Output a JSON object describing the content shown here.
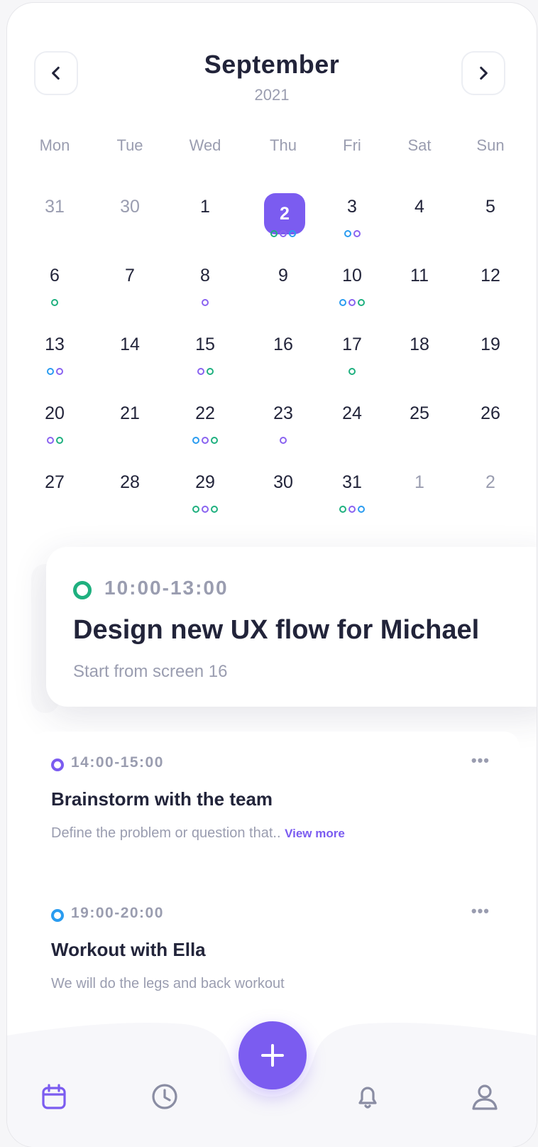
{
  "header": {
    "month": "September",
    "year": "2021",
    "prev_icon": "chevron-left-icon",
    "next_icon": "chevron-right-icon"
  },
  "calendar": {
    "weekdays": [
      "Mon",
      "Tue",
      "Wed",
      "Thu",
      "Fri",
      "Sat",
      "Sun"
    ],
    "colors": {
      "green": "#1fb07f",
      "purple": "#8a63f0",
      "blue": "#2a9cf0"
    },
    "selected_day": "2",
    "weeks": [
      [
        {
          "d": "31",
          "muted": true,
          "dots": []
        },
        {
          "d": "30",
          "muted": true,
          "dots": []
        },
        {
          "d": "1",
          "dots": []
        },
        {
          "d": "2",
          "selected": true,
          "dots": [
            "green",
            "purple",
            "blue"
          ]
        },
        {
          "d": "3",
          "dots": [
            "blue",
            "purple"
          ]
        },
        {
          "d": "4",
          "dots": []
        },
        {
          "d": "5",
          "dots": []
        }
      ],
      [
        {
          "d": "6",
          "dots": [
            "green"
          ]
        },
        {
          "d": "7",
          "dots": []
        },
        {
          "d": "8",
          "dots": [
            "purple"
          ]
        },
        {
          "d": "9",
          "dots": []
        },
        {
          "d": "10",
          "dots": [
            "blue",
            "purple",
            "green"
          ]
        },
        {
          "d": "11",
          "dots": []
        },
        {
          "d": "12",
          "dots": []
        }
      ],
      [
        {
          "d": "13",
          "dots": [
            "blue",
            "purple"
          ]
        },
        {
          "d": "14",
          "dots": []
        },
        {
          "d": "15",
          "dots": [
            "purple",
            "green"
          ]
        },
        {
          "d": "16",
          "dots": []
        },
        {
          "d": "17",
          "dots": [
            "green"
          ]
        },
        {
          "d": "18",
          "dots": []
        },
        {
          "d": "19",
          "dots": []
        }
      ],
      [
        {
          "d": "20",
          "dots": [
            "purple",
            "green"
          ]
        },
        {
          "d": "21",
          "dots": []
        },
        {
          "d": "22",
          "dots": [
            "blue",
            "purple",
            "green"
          ]
        },
        {
          "d": "23",
          "dots": [
            "purple"
          ]
        },
        {
          "d": "24",
          "dots": []
        },
        {
          "d": "25",
          "dots": []
        },
        {
          "d": "26",
          "dots": []
        }
      ],
      [
        {
          "d": "27",
          "dots": []
        },
        {
          "d": "28",
          "dots": []
        },
        {
          "d": "29",
          "dots": [
            "green",
            "purple",
            "green"
          ]
        },
        {
          "d": "30",
          "dots": []
        },
        {
          "d": "31",
          "dots": [
            "green",
            "purple",
            "blue"
          ]
        },
        {
          "d": "1",
          "muted": true,
          "dots": []
        },
        {
          "d": "2",
          "muted": true,
          "dots": []
        }
      ]
    ]
  },
  "featured_event": {
    "time": "10:00-13:00",
    "title": "Design new UX flow for Michael",
    "subtitle": "Start from screen 16",
    "color": "#1fb07f"
  },
  "events": [
    {
      "time": "14:00-15:00",
      "title": "Brainstorm with the team",
      "description": "Define the problem or question that..",
      "view_more": "View more",
      "color": "#7b5cf0",
      "menu": "•••"
    },
    {
      "time": "19:00-20:00",
      "title": "Workout with Ella",
      "description": "We will do the legs and back workout",
      "color": "#2a9cf0",
      "menu": "•••"
    }
  ],
  "bottom_nav": {
    "items": [
      "calendar-icon",
      "clock-icon",
      "bell-icon",
      "user-icon"
    ],
    "active": "calendar-icon",
    "add_icon": "plus-icon"
  }
}
